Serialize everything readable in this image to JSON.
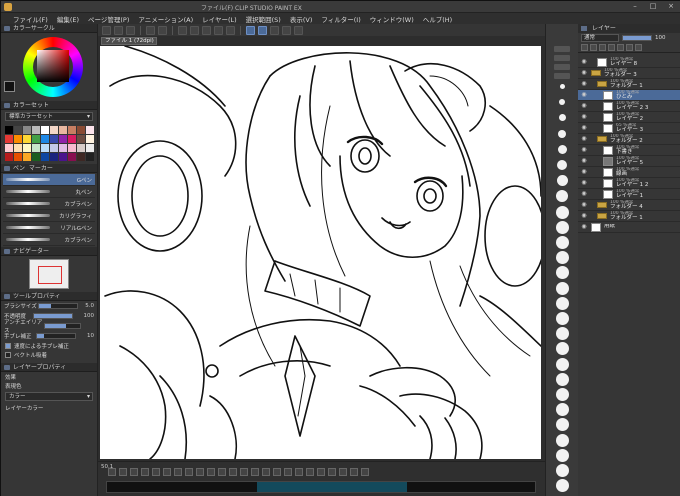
{
  "window": {
    "title": "ファイル(F)  CLIP STUDIO PAINT EX"
  },
  "menu": [
    "ファイル(F)",
    "編集(E)",
    "ページ管理(P)",
    "アニメーション(A)",
    "レイヤー(L)",
    "選択範囲(S)",
    "表示(V)",
    "フィルター(I)",
    "ウィンドウ(W)",
    "ヘルプ(H)"
  ],
  "left_panel": {
    "color_wheel_header": "カラーサークル",
    "color_set_header": "カラーセット",
    "color_set_name": "標準カラーセット",
    "subtool_header": "サブツール",
    "subtool_tabs": [
      "ペン",
      "マーカー"
    ],
    "brushes": [
      {
        "name": "Gペン"
      },
      {
        "name": "丸ペン"
      },
      {
        "name": "カブラペン"
      },
      {
        "name": "カリグラフィ"
      },
      {
        "name": "リアルGペン"
      },
      {
        "name": "カブラペン"
      }
    ],
    "navigator_header": "ナビゲーター",
    "tool_property_header": "ツールプロパティ",
    "properties": [
      {
        "label": "ブラシサイズ",
        "value": "5.0",
        "fill": 0.3
      },
      {
        "label": "不透明度",
        "value": "100",
        "fill": 1.0
      },
      {
        "label": "アンチエイリアス",
        "value": "",
        "fill": 0.6
      },
      {
        "label": "手ブレ補正",
        "value": "10",
        "fill": 0.2
      }
    ],
    "checks": [
      {
        "label": "速度による手ブレ補正",
        "on": true
      },
      {
        "label": "ベクトル吸着",
        "on": false
      }
    ],
    "layer_property_header": "レイヤープロパティ",
    "effect_label": "効果",
    "expression_label": "表現色",
    "expression_value": "カラー",
    "layer_color_label": "レイヤーカラー"
  },
  "canvas": {
    "doc_tab": "ファイル 1 (72dpi)"
  },
  "bottom": {
    "zoom_readout": "50.1"
  },
  "layer_panel": {
    "header": "レイヤー",
    "blend_mode": "通常",
    "opacity": "100",
    "layers": [
      {
        "mode": "100 %通常",
        "name": "レイヤー 8",
        "type": "layer",
        "indent": 1
      },
      {
        "mode": "100 %通常",
        "name": "フォルダー 3",
        "type": "folder",
        "indent": 0
      },
      {
        "mode": "100 %通常",
        "name": "フォルダー 1",
        "type": "folder",
        "indent": 1
      },
      {
        "mode": "100 %通常",
        "name": "ひとみ",
        "type": "layer",
        "indent": 2,
        "selected": true
      },
      {
        "mode": "100 %通常",
        "name": "レイヤー 2 3",
        "type": "layer",
        "indent": 2
      },
      {
        "mode": "100 %通常",
        "name": "レイヤー 2",
        "type": "layer",
        "indent": 2
      },
      {
        "mode": "65 %通常",
        "name": "レイヤー 3",
        "type": "layer",
        "indent": 2
      },
      {
        "mode": "100 %通常",
        "name": "フォルダー 2",
        "type": "folder",
        "indent": 1
      },
      {
        "mode": "100 %通常",
        "name": "下書き",
        "type": "layer",
        "indent": 2
      },
      {
        "mode": "100 %通常",
        "name": "レイヤー 5",
        "type": "dark",
        "indent": 2
      },
      {
        "mode": "100 %通常",
        "name": "線画",
        "type": "layer",
        "indent": 2
      },
      {
        "mode": "100 %通常",
        "name": "レイヤー 1 2",
        "type": "layer",
        "indent": 2
      },
      {
        "mode": "100 %通常",
        "name": "レイヤー 1",
        "type": "layer",
        "indent": 2
      },
      {
        "mode": "100 %通常",
        "name": "フォルダー 4",
        "type": "folder",
        "indent": 1
      },
      {
        "mode": "100 %通常",
        "name": "フォルダー 1",
        "type": "folder",
        "indent": 1
      },
      {
        "mode": "",
        "name": "用紙",
        "type": "layer",
        "indent": 0
      }
    ]
  }
}
